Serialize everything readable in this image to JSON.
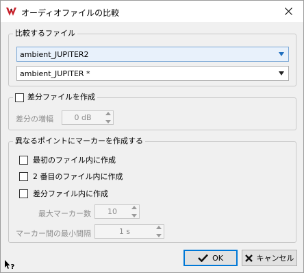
{
  "window": {
    "title": "オーディオファイルの比較",
    "accent_color": "#0078d7"
  },
  "files_group": {
    "legend": "比較するファイル",
    "file1": "ambient_JUPITER2",
    "file2": "ambient_JUPITER *"
  },
  "diff_group": {
    "legend": "差分ファイルを作成",
    "checked": false,
    "gain_label": "差分の増幅",
    "gain_value": "0 dB"
  },
  "markers_group": {
    "legend": "異なるポイントにマーカーを作成する",
    "options": [
      {
        "label": "最初のファイル内に作成",
        "checked": false
      },
      {
        "label": "2 番目のファイル内に作成",
        "checked": false
      },
      {
        "label": "差分ファイル内に作成",
        "checked": false
      }
    ],
    "max_markers_label": "最大マーカー数",
    "max_markers_value": "10",
    "min_interval_label": "マーカー間の最小間隔",
    "min_interval_value": "1 s"
  },
  "buttons": {
    "ok": "OK",
    "cancel": "キャンセル"
  },
  "icons": {
    "app": "app-logo-icon",
    "close": "close-icon",
    "help": "help-cursor-icon",
    "ok": "checkmark-icon",
    "cancel": "x-icon"
  }
}
